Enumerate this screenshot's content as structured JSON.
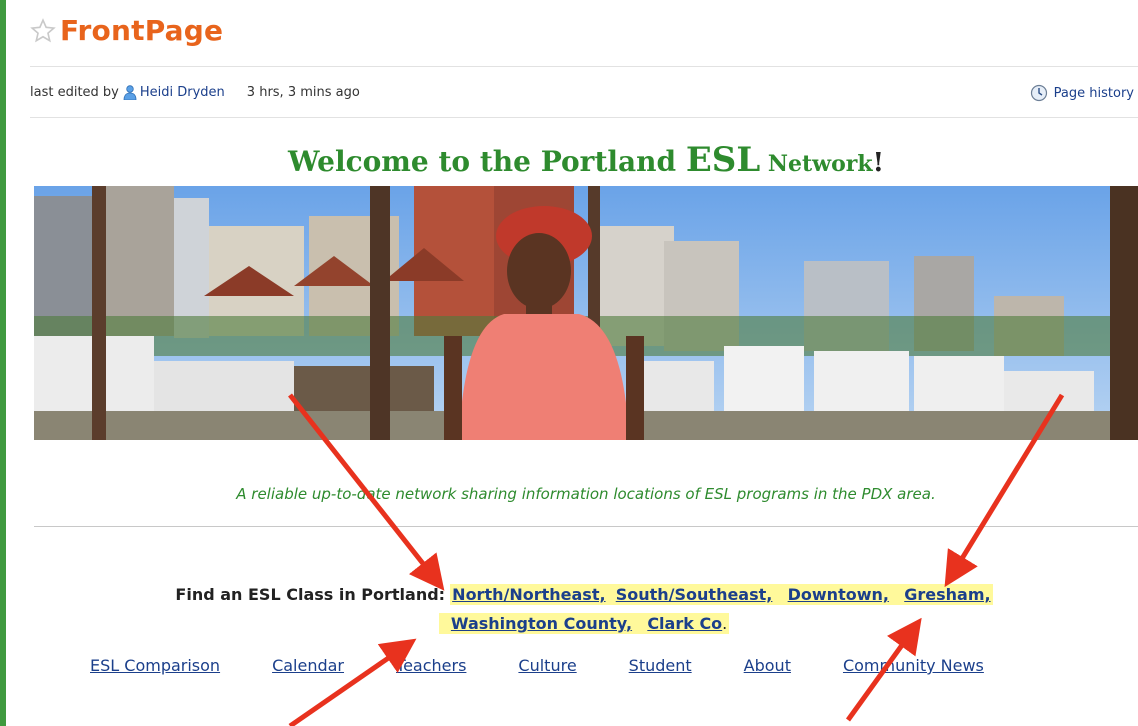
{
  "page": {
    "title": "FrontPage",
    "meta_prefix": "last edited by",
    "author": "Heidi Dryden",
    "edited_ago": "3 hrs, 3 mins ago",
    "history_label": "Page history"
  },
  "welcome": {
    "part1": "Welcome to the Portland ",
    "part2": "ESL",
    "part3": " Network",
    "part4": "!"
  },
  "tagline": "A reliable up-to-date network sharing information locations of ESL programs in the PDX area.",
  "find": {
    "label": "Find an ESL Class in Portland:",
    "links": [
      "North/Northeast,",
      "South/Southeast,",
      "Downtown,",
      "Gresham,",
      "Washington County,",
      "Clark Co"
    ],
    "end": "."
  },
  "nav": [
    "ESL Comparison",
    "Calendar",
    "Teachers",
    "Culture",
    "Student",
    "About",
    "Community News"
  ],
  "colors": {
    "accent": "#e8641c",
    "green": "#2e8b2e",
    "link": "#1b3f8b",
    "highlight": "#fff99b",
    "arrow": "#e8321e"
  }
}
